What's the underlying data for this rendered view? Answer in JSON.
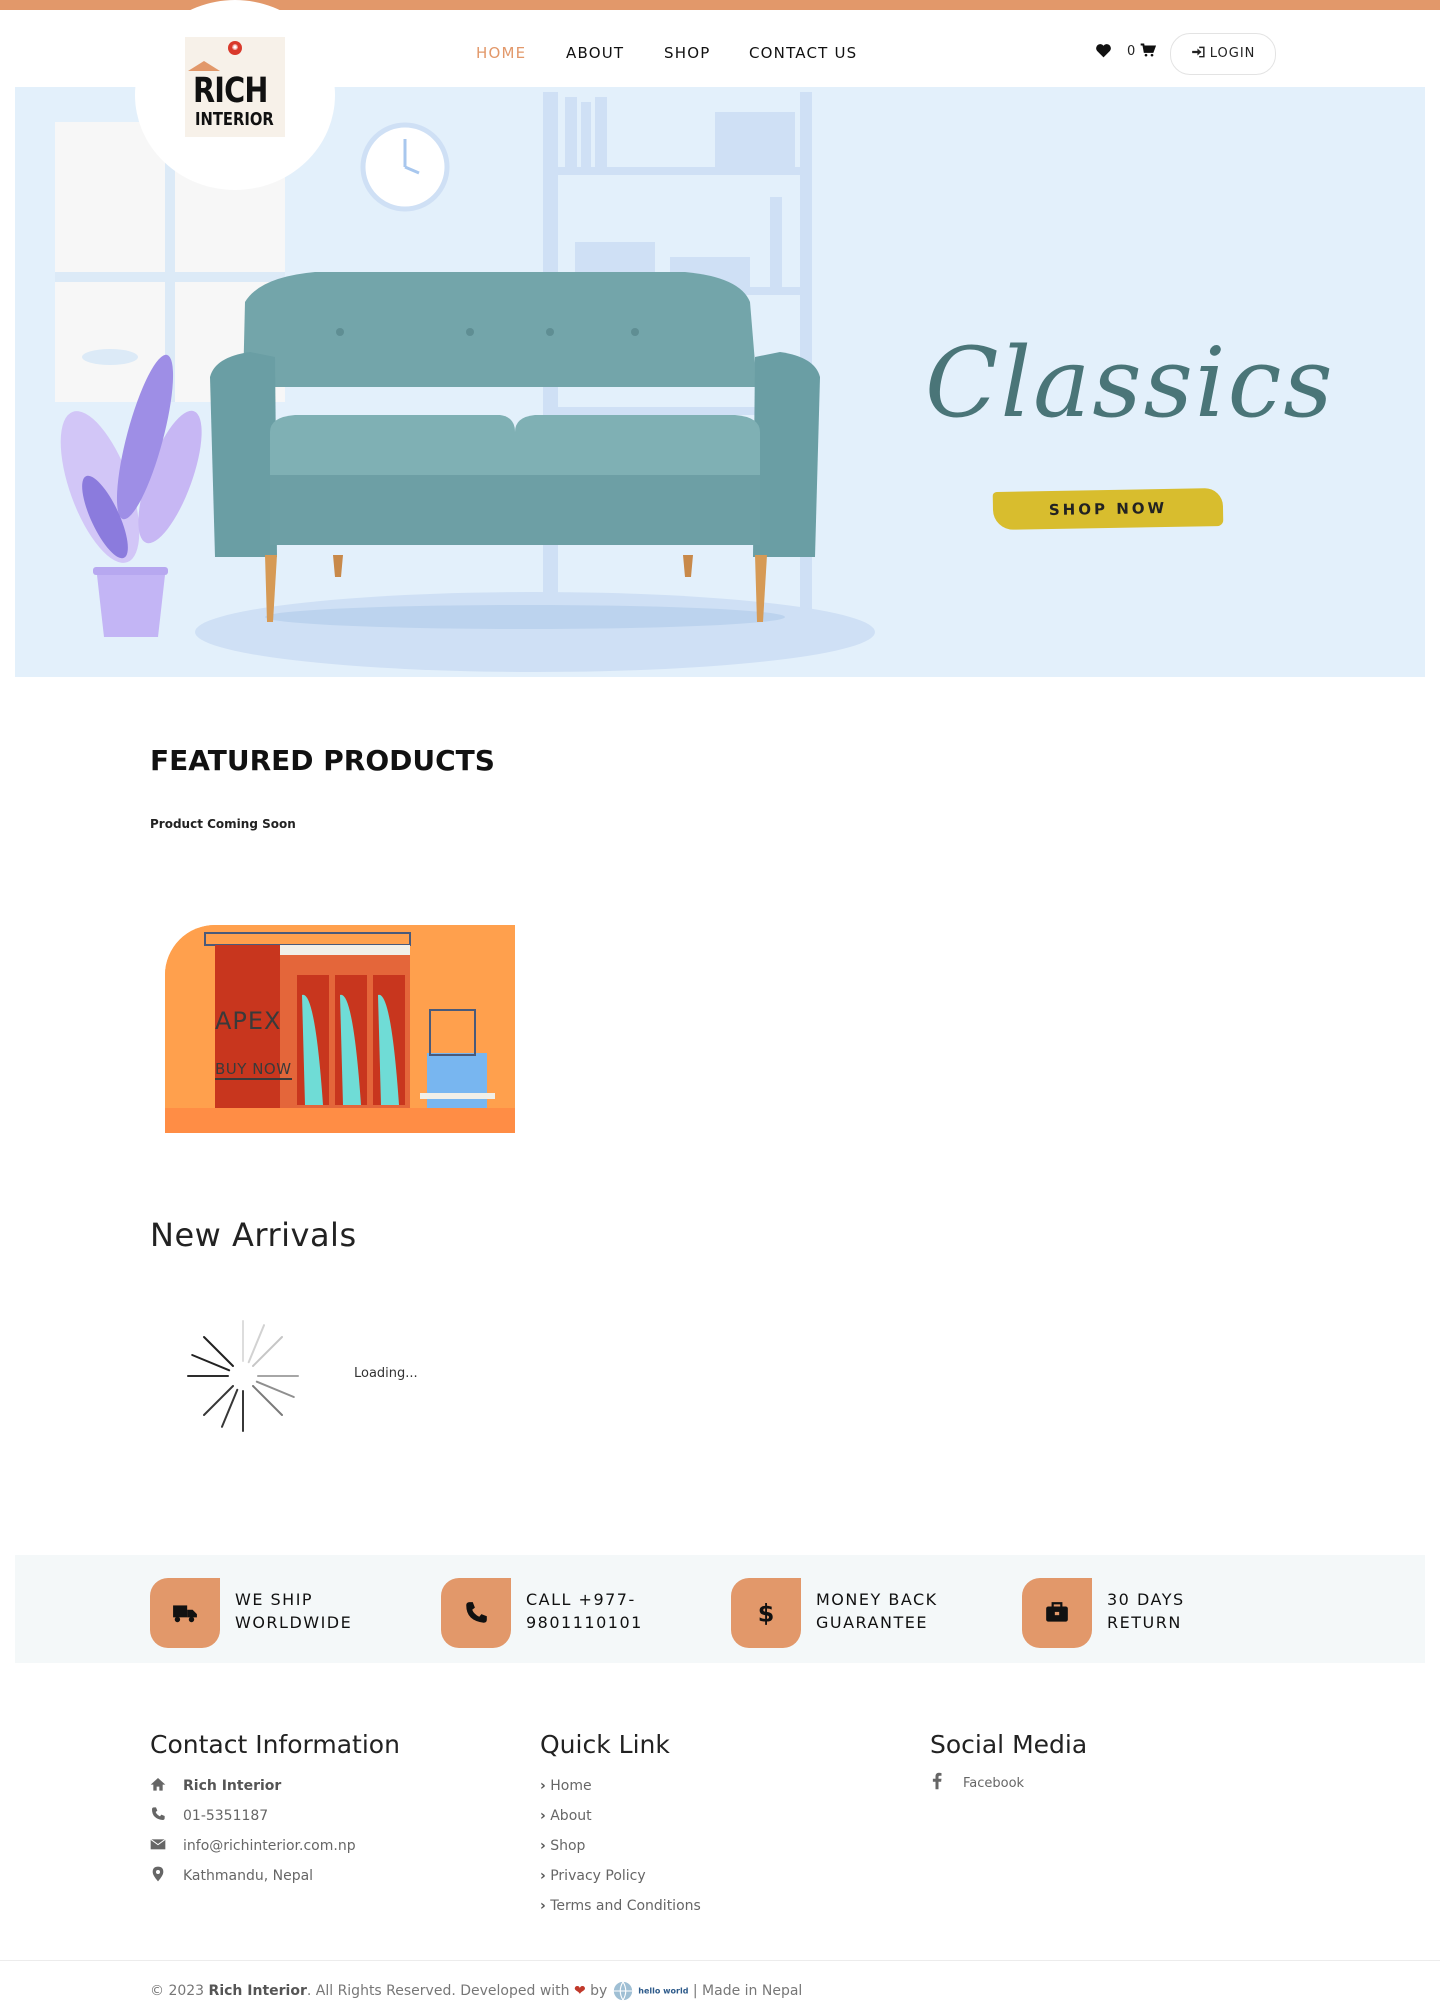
{
  "nav": {
    "items": [
      {
        "label": "HOME",
        "active": true
      },
      {
        "label": "ABOUT",
        "active": false
      },
      {
        "label": "SHOP",
        "active": false
      },
      {
        "label": "CONTACT US",
        "active": false
      }
    ],
    "cart_count": "0",
    "login_label": "LOGIN",
    "logo_line1": "RICH",
    "logo_line2": "INTERIOR"
  },
  "colors": {
    "accent": "#e2986a",
    "hero_bg": "#e3f0fb",
    "cta_yellow": "#d8bd2e",
    "script_teal": "#4a7578"
  },
  "hero": {
    "title": "Classics",
    "cta_label": "SHOP NOW"
  },
  "featured": {
    "title": "FEATURED PRODUCTS",
    "subtitle": "Product Coming Soon",
    "promo_title": "APEX",
    "promo_cta": "BUY NOW"
  },
  "arrivals": {
    "title": "New Arrivals",
    "loading_text": "Loading..."
  },
  "features": [
    {
      "line1": "WE SHIP",
      "line2": "WORLDWIDE",
      "icon": "truck-icon"
    },
    {
      "line1": "CALL +977-",
      "line2": "9801110101",
      "icon": "phone-icon"
    },
    {
      "line1": "MONEY BACK",
      "line2": "GUARANTEE",
      "icon": "dollar-icon"
    },
    {
      "line1": "30 DAYS",
      "line2": "RETURN",
      "icon": "briefcase-icon"
    }
  ],
  "footer": {
    "contact_title": "Contact Information",
    "contact": {
      "name": "Rich Interior",
      "phone": "01-5351187",
      "email": "info@richinterior.com.np",
      "address": "Kathmandu, Nepal"
    },
    "quick_title": "Quick Link",
    "quick_links": [
      "Home",
      "About",
      "Shop",
      "Privacy Policy",
      "Terms and Conditions"
    ],
    "social_title": "Social Media",
    "social": [
      "Facebook"
    ]
  },
  "copyright": {
    "prefix": "© 2023",
    "company": "Rich Interior",
    "middle": ". All Rights Reserved. Developed with",
    "by": "by",
    "dev_logo_text": "hello world",
    "suffix": "| Made in Nepal"
  }
}
